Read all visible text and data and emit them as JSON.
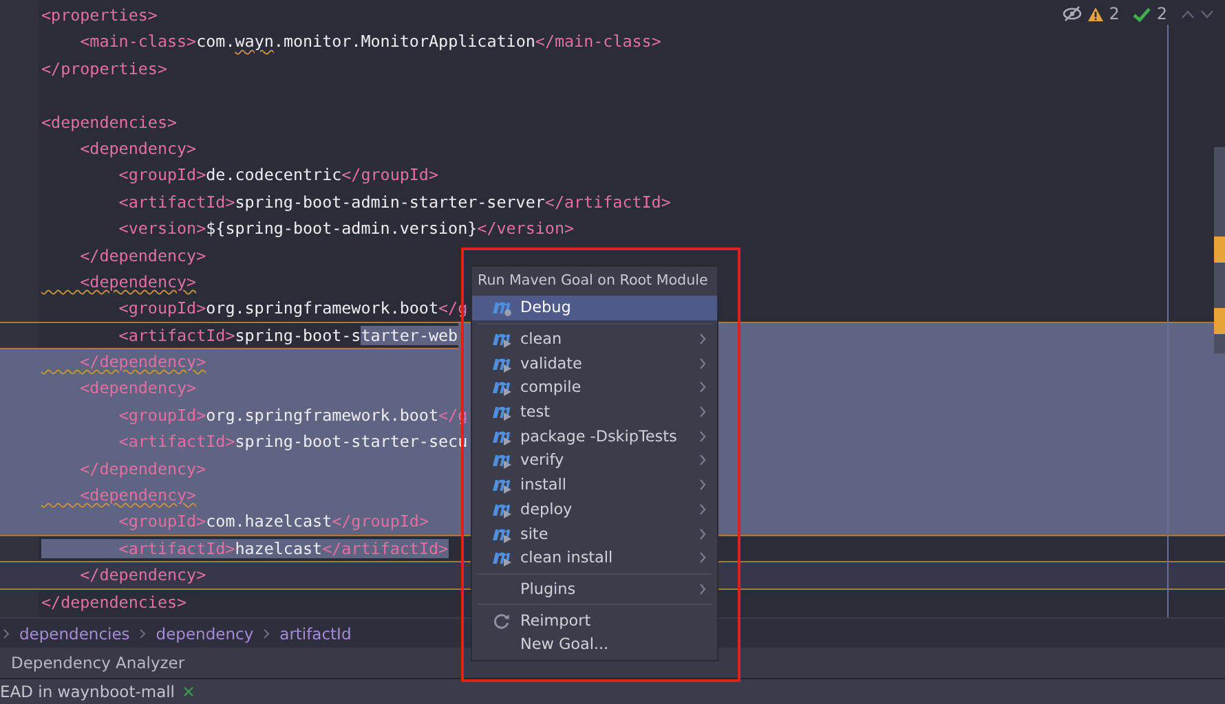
{
  "editor": {
    "indicators": {
      "warnings": "2",
      "checks": "2"
    },
    "lines": [
      {
        "kind": "code",
        "parts": [
          {
            "kind": "tag",
            "text": "<properties>"
          }
        ]
      },
      {
        "kind": "code",
        "parts": [
          {
            "kind": "tag",
            "text": "    <main-class>"
          },
          {
            "kind": "text",
            "text": "com."
          },
          {
            "kind": "text",
            "text": "wayn",
            "typo": true
          },
          {
            "kind": "text",
            "text": ".monitor.MonitorApplication"
          },
          {
            "kind": "tag",
            "text": "</main-class>"
          }
        ]
      },
      {
        "kind": "code",
        "parts": [
          {
            "kind": "tag",
            "text": "</properties>"
          }
        ]
      },
      {
        "kind": "blank"
      },
      {
        "kind": "code",
        "parts": [
          {
            "kind": "tag",
            "text": "<dependencies>"
          }
        ]
      },
      {
        "kind": "code",
        "parts": [
          {
            "kind": "tag",
            "text": "    <dependency>"
          }
        ]
      },
      {
        "kind": "code",
        "parts": [
          {
            "kind": "tag",
            "text": "        <groupId>"
          },
          {
            "kind": "text",
            "text": "de.codecentric"
          },
          {
            "kind": "tag",
            "text": "</groupId>"
          }
        ]
      },
      {
        "kind": "code",
        "parts": [
          {
            "kind": "tag",
            "text": "        <artifactId>"
          },
          {
            "kind": "text",
            "text": "spring-boot-admin-starter-server"
          },
          {
            "kind": "tag",
            "text": "</artifactId>"
          }
        ]
      },
      {
        "kind": "code",
        "parts": [
          {
            "kind": "tag",
            "text": "        <version>"
          },
          {
            "kind": "text",
            "text": "${spring-boot-admin.version}"
          },
          {
            "kind": "tag",
            "text": "</version>"
          }
        ]
      },
      {
        "kind": "code",
        "parts": [
          {
            "kind": "tag",
            "text": "    </dependency>"
          }
        ]
      },
      {
        "kind": "code",
        "parts": [
          {
            "kind": "tag",
            "text": "    <dependency>",
            "typo": true
          }
        ]
      },
      {
        "kind": "code",
        "warning": true,
        "parts": [
          {
            "kind": "tag",
            "text": "        <groupId>"
          },
          {
            "kind": "text",
            "text": "org.springframework.boot"
          },
          {
            "kind": "tag",
            "text": "</g"
          }
        ]
      },
      {
        "kind": "code",
        "warning": true,
        "select_to_end": true,
        "parts": [
          {
            "kind": "tag",
            "text": "        <artifactId>"
          },
          {
            "kind": "text",
            "text": "spring-boot-s"
          },
          {
            "kind": "text",
            "text": "tarter-web",
            "selected": true
          }
        ]
      },
      {
        "kind": "code",
        "selected": true,
        "parts": [
          {
            "kind": "tag",
            "text": "    </dependency>",
            "typo": true
          }
        ]
      },
      {
        "kind": "code",
        "selected": true,
        "parts": [
          {
            "kind": "tag",
            "text": "    <dependency>"
          }
        ]
      },
      {
        "kind": "code",
        "selected": true,
        "parts": [
          {
            "kind": "tag",
            "text": "        <groupId>"
          },
          {
            "kind": "text",
            "text": "org.springframework.boot"
          },
          {
            "kind": "tag",
            "text": "</g"
          }
        ]
      },
      {
        "kind": "code",
        "selected": true,
        "parts": [
          {
            "kind": "tag",
            "text": "        <artifactId>"
          },
          {
            "kind": "text",
            "text": "spring-boot-starter-secu"
          }
        ]
      },
      {
        "kind": "code",
        "selected": true,
        "parts": [
          {
            "kind": "tag",
            "text": "    </dependency>"
          }
        ]
      },
      {
        "kind": "code",
        "selected": true,
        "parts": [
          {
            "kind": "tag",
            "text": "    <dependency>",
            "typo": true
          }
        ]
      },
      {
        "kind": "code",
        "selected": true,
        "warning": true,
        "parts": [
          {
            "kind": "tag",
            "text": "        <groupId>"
          },
          {
            "kind": "text",
            "text": "com.hazelcast"
          },
          {
            "kind": "tag",
            "text": "</groupId>"
          }
        ]
      },
      {
        "kind": "code",
        "warning": true,
        "parts": [
          {
            "kind": "tag",
            "text": "        <artifactId>",
            "selected": true
          },
          {
            "kind": "text",
            "text": "hazelcast",
            "selected": true
          },
          {
            "kind": "tag",
            "text": "</artifactId>",
            "selected": true
          }
        ]
      },
      {
        "kind": "code",
        "current": true,
        "warning": true,
        "parts": [
          {
            "kind": "tag",
            "text": "    </dependency>"
          }
        ]
      },
      {
        "kind": "code",
        "parts": [
          {
            "kind": "tag",
            "text": "</dependencies>"
          }
        ]
      }
    ]
  },
  "menu": {
    "title": "Run Maven Goal on Root Module",
    "items": [
      {
        "kind": "debug",
        "label": "Debug",
        "selected": true
      },
      {
        "kind": "separator"
      },
      {
        "kind": "goal",
        "label": "clean",
        "selected": false
      },
      {
        "kind": "goal",
        "label": "validate",
        "selected": false
      },
      {
        "kind": "goal",
        "label": "compile",
        "selected": false
      },
      {
        "kind": "goal",
        "label": "test",
        "selected": false
      },
      {
        "kind": "goal",
        "label": "package -DskipTests",
        "selected": false
      },
      {
        "kind": "goal",
        "label": "verify",
        "selected": false
      },
      {
        "kind": "goal",
        "label": "install",
        "selected": false
      },
      {
        "kind": "goal",
        "label": "deploy",
        "selected": false
      },
      {
        "kind": "goal",
        "label": "site",
        "selected": false
      },
      {
        "kind": "goal",
        "label": "clean install",
        "selected": false
      },
      {
        "kind": "separator"
      },
      {
        "kind": "submenu",
        "label": "Plugins",
        "selected": false
      },
      {
        "kind": "separator"
      },
      {
        "kind": "reimport",
        "label": "Reimport",
        "selected": false
      },
      {
        "kind": "action",
        "label": "New Goal...",
        "selected": false
      }
    ]
  },
  "highlight_frame": true,
  "breadcrumbs": [
    "dependencies",
    "dependency",
    "artifactId"
  ],
  "tool_tab": "Dependency Analyzer",
  "status_bar": {
    "text": "EAD in waynboot-mall"
  }
}
